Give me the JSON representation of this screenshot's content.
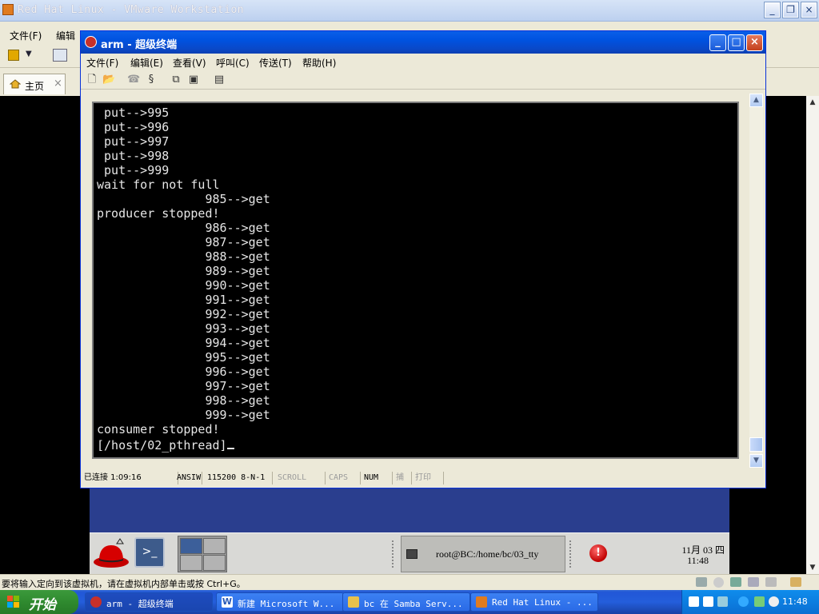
{
  "vmware": {
    "title": "Red Hat Linux - VMware Workstation",
    "menu": {
      "file": "文件(F)",
      "edit": "编辑"
    },
    "tabs": [
      {
        "label": "主页",
        "close": "×"
      }
    ],
    "controls": {
      "minimize": "_",
      "maximize": "❐",
      "close": "×"
    },
    "status_message": "要将输入定向到该虚拟机，请在虚拟机内部单击或按 Ctrl+G。"
  },
  "hyperterminal": {
    "title": "arm - 超级终端",
    "menu": [
      "文件(F)",
      "编辑(E)",
      "查看(V)",
      "呼叫(C)",
      "传送(T)",
      "帮助(H)"
    ],
    "controls": {
      "minimize": "_",
      "maximize": "□",
      "close": "×"
    },
    "terminal_lines": [
      " put-->995",
      " put-->996",
      " put-->997",
      " put-->998",
      " put-->999",
      "wait for not full",
      "               985-->get",
      "producer stopped!",
      "               986-->get",
      "               987-->get",
      "               988-->get",
      "               989-->get",
      "               990-->get",
      "               991-->get",
      "               992-->get",
      "               993-->get",
      "               994-->get",
      "               995-->get",
      "               996-->get",
      "               997-->get",
      "               998-->get",
      "               999-->get",
      "consumer stopped!",
      "[/host/02_pthread]"
    ],
    "status": {
      "connected": "已连接 1:09:16",
      "emulation": "ANSIW",
      "port": "115200 8-N-1",
      "scroll": "SCROLL",
      "caps": "CAPS",
      "num": "NUM",
      "capture": "捕",
      "print": "打印"
    }
  },
  "guest": {
    "task_button": "root@BC:/home/bc/03_tty",
    "clock_date": "11月 03 四",
    "clock_time": "11:48"
  },
  "xp_taskbar": {
    "start": "开始",
    "tasks": [
      {
        "label": "arm - 超级终端"
      },
      {
        "label": "新建 Microsoft W..."
      },
      {
        "label": "bc 在 Samba Serv..."
      },
      {
        "label": "Red Hat Linux - ..."
      }
    ],
    "clock": "11:48"
  },
  "colors": {
    "xp_blue": "#245edb",
    "xp_green": "#2f8a2f",
    "terminal_bg": "#000000",
    "terminal_fg": "#e6e6e6",
    "guest_desktop": "#2a3e8e"
  }
}
